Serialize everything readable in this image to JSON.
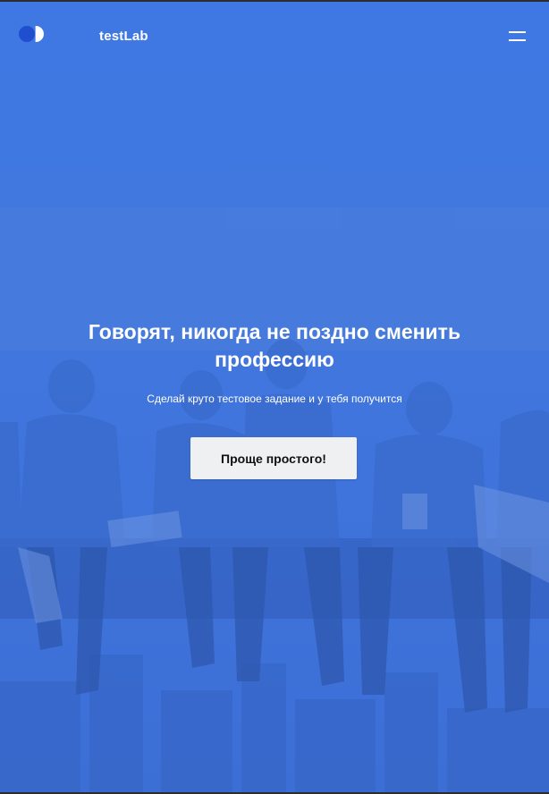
{
  "header": {
    "brand": "testLab",
    "menu_icon": "hamburger-menu-icon",
    "logo_icon": "toggle-logo-icon"
  },
  "hero": {
    "title": "Говорят, никогда не поздно сменить профессию",
    "subtitle": "Сделай круто тестовое задание и у тебя получится",
    "cta_label": "Проще простого!"
  },
  "colors": {
    "overlay": "#3f78e2",
    "logo_dark": "#1f4fcf",
    "button_bg": "#eef0f2",
    "text_light": "#ffffff",
    "button_text": "#111111"
  }
}
